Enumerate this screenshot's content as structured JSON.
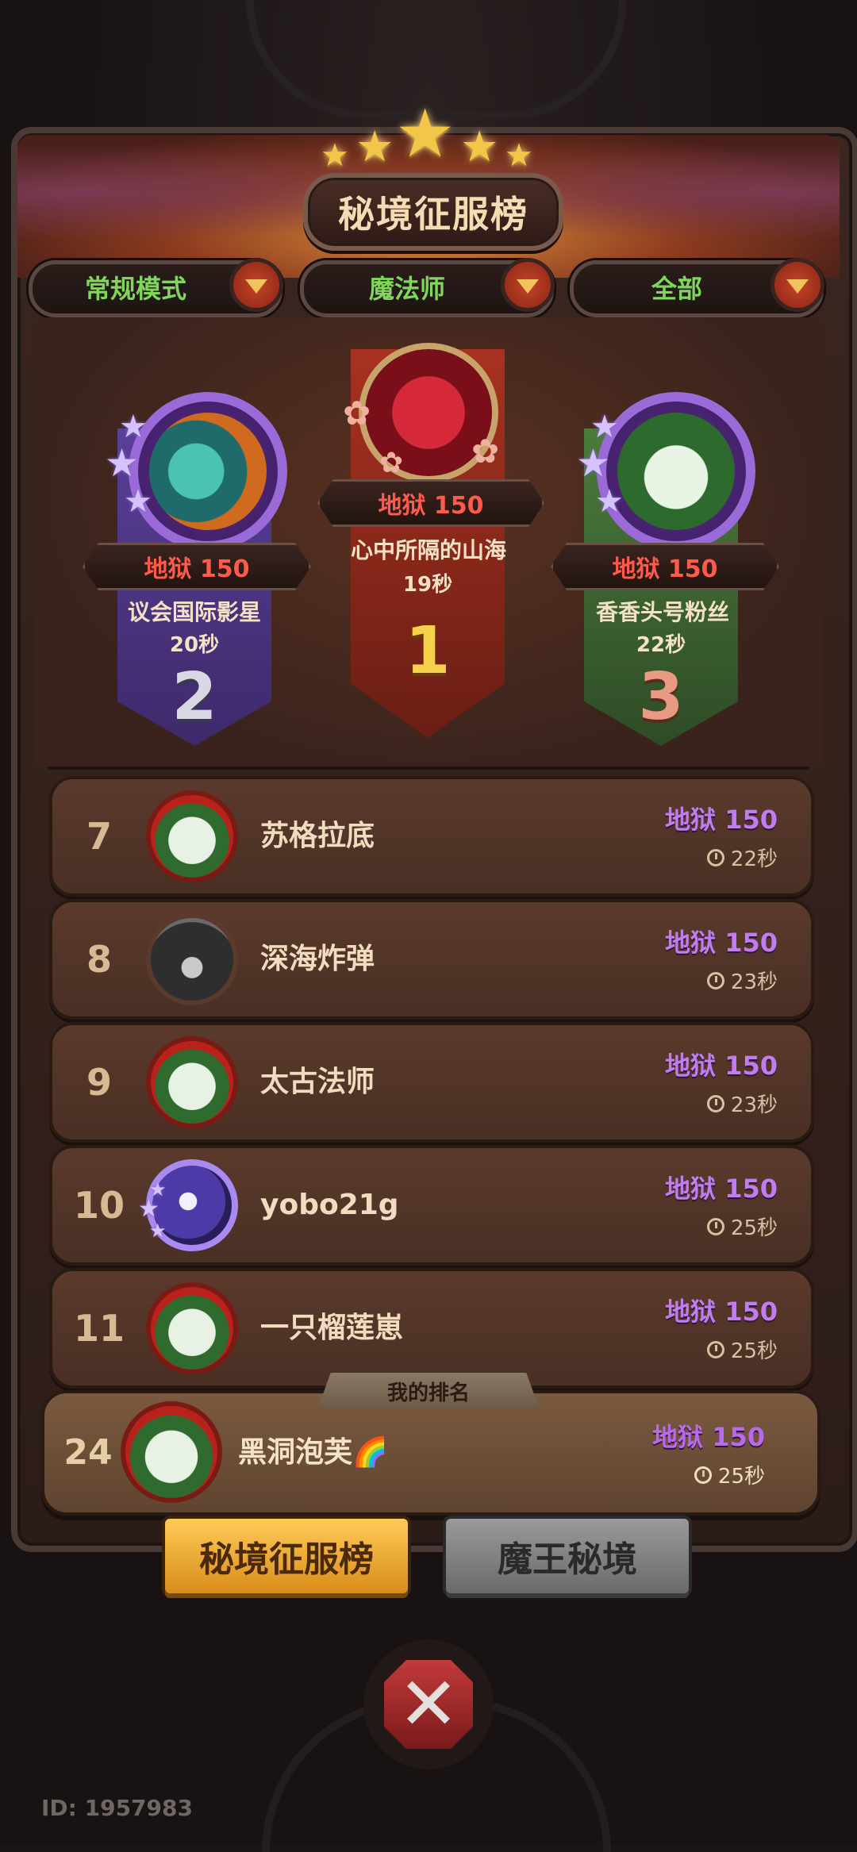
{
  "title": "秘境征服榜",
  "filters": [
    {
      "label": "常规模式"
    },
    {
      "label": "魔法师"
    },
    {
      "label": "全部"
    }
  ],
  "podium": {
    "first": {
      "rank": "1",
      "difficulty": "地狱 150",
      "name": "心中所隔的山海",
      "time": "19秒"
    },
    "second": {
      "rank": "2",
      "difficulty": "地狱 150",
      "name": "议会国际影星",
      "time": "20秒"
    },
    "third": {
      "rank": "3",
      "difficulty": "地狱 150",
      "name": "香香头号粉丝",
      "time": "22秒"
    }
  },
  "list": [
    {
      "rank": "7",
      "name": "苏格拉底",
      "difficulty": "地狱 150",
      "time": "22秒",
      "avatar": "xmas-avatar"
    },
    {
      "rank": "8",
      "name": "深海炸弹",
      "difficulty": "地狱 150",
      "time": "23秒",
      "avatar": "hooded-avatar"
    },
    {
      "rank": "9",
      "name": "太古法师",
      "difficulty": "地狱 150",
      "time": "23秒",
      "avatar": "xmas-avatar"
    },
    {
      "rank": "10",
      "name": "yobo21g",
      "difficulty": "地狱 150",
      "time": "25秒",
      "avatar": "moon-avatar"
    },
    {
      "rank": "11",
      "name": "一只榴莲崽",
      "difficulty": "地狱 150",
      "time": "25秒",
      "avatar": "xmas-avatar"
    }
  ],
  "my_rank": {
    "label": "我的排名",
    "rank": "24",
    "name": "黑洞泡芙🌈",
    "difficulty": "地狱 150",
    "time": "25秒"
  },
  "tabs": [
    {
      "label": "秘境征服榜",
      "active": true
    },
    {
      "label": "魔王秘境",
      "active": false
    }
  ],
  "user_id": "ID: 1957983",
  "colors": {
    "filter_text": "#7fd65a",
    "difficulty_podium": "#ff5a4a",
    "difficulty_list": "#c07cf0",
    "tab_active": "#f5b63a"
  }
}
